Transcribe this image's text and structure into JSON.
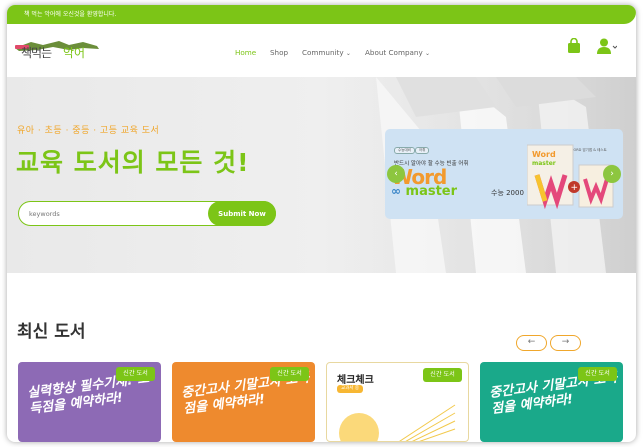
{
  "topbar": {
    "notice": "책 먹는 악어에 오신것을 환영합니다."
  },
  "logo": {
    "part1": "책먹는",
    "part2": "악어"
  },
  "nav": {
    "items": [
      {
        "label": "Home",
        "active": true
      },
      {
        "label": "Shop",
        "active": false
      },
      {
        "label": "Community",
        "dropdown": true
      },
      {
        "label": "About Company",
        "dropdown": true
      }
    ]
  },
  "icons": {
    "cart": "shopping-bag-icon",
    "user": "user-icon"
  },
  "hero": {
    "subtitle": "유아 · 초등 · 중등 · 고등 교육 도서",
    "title": "교육 도서의 모든 것!",
    "search": {
      "placeholder": "keywords",
      "button": "Submit Now"
    }
  },
  "banner": {
    "tags": [
      "수능대비",
      "어휘"
    ],
    "desc": "반드시 알아야 할 수능 빈출 어휘",
    "brand1": "Word",
    "brand2": "master",
    "brand_suffix": "수능 2000",
    "chip": "WORD 암기앱 & 테스트",
    "prev": "‹",
    "next": "›"
  },
  "section": {
    "title": "최신 도서"
  },
  "pager": {
    "prev": "←",
    "next": "→"
  },
  "cards": [
    {
      "badge": "신간 도서",
      "art": "실력향상 필수기재! 고득점을 예약하라!",
      "bg": "#8d6ab5"
    },
    {
      "badge": "신간 도서",
      "art": "중간고사 기말고사 고득점을 예약하라!",
      "bg": "#ee8a2e"
    },
    {
      "badge": "신간 도서",
      "art": "체크체크",
      "sub": "교과서 중",
      "bg": "#ffffff"
    },
    {
      "badge": "신간 도서",
      "art": "중간고사 기말고사 고득점을 예약하라!",
      "bg": "#1aa98a"
    }
  ],
  "colors": {
    "accent": "#7cc517",
    "orange": "#f0a72c"
  }
}
